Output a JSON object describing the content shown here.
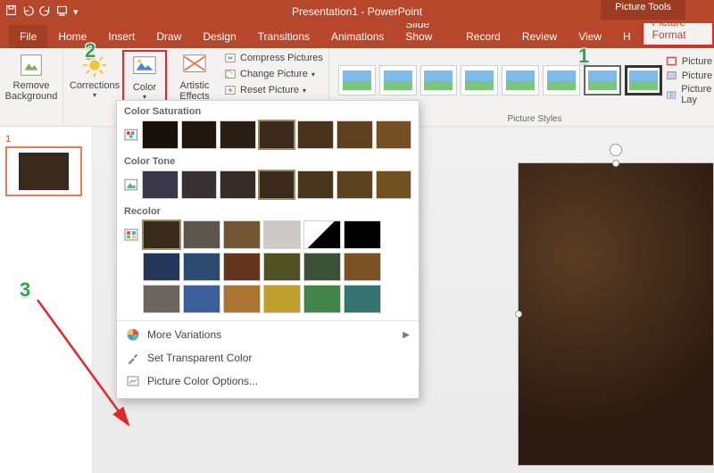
{
  "title": {
    "doc": "Presentation1",
    "app": "PowerPoint"
  },
  "context_tab": "Picture Tools",
  "tabs": {
    "file": "File",
    "home": "Home",
    "insert": "Insert",
    "draw": "Draw",
    "design": "Design",
    "transitions": "Transitions",
    "animations": "Animations",
    "slideshow": "Slide Show",
    "record": "Record",
    "review": "Review",
    "view": "View",
    "help": "H",
    "format": "Picture Format"
  },
  "ribbon": {
    "removebg": "Remove\nBackground",
    "corrections": "Corrections",
    "color": "Color",
    "artistic": "Artistic\nEffects",
    "compress": "Compress Pictures",
    "change": "Change Picture",
    "reset": "Reset Picture",
    "pstyles_label": "Picture Styles",
    "border": "Picture Bo",
    "effects": "Picture Ef",
    "layout": "Picture Lay"
  },
  "dropdown": {
    "saturation": "Color Saturation",
    "tone": "Color Tone",
    "recolor": "Recolor",
    "more_variations": "More Variations",
    "set_transparent": "Set Transparent Color",
    "options": "Picture Color Options..."
  },
  "slide": {
    "num": "1"
  },
  "callouts": {
    "one": "1",
    "two": "2",
    "three": "3"
  },
  "palette": {
    "saturation_overlays": [
      "rgba(0,0,0,.6)",
      "rgba(0,0,0,.45)",
      "rgba(0,0,0,.25)",
      "rgba(0,0,0,0)",
      "rgba(166,110,40,.15)",
      "rgba(166,110,40,.35)",
      "rgba(166,110,40,.55)"
    ],
    "tone_overlays": [
      "rgba(60,80,160,.35)",
      "rgba(60,80,160,.18)",
      "rgba(60,80,160,.08)",
      "rgba(0,0,0,0)",
      "rgba(200,140,40,.12)",
      "rgba(200,140,40,.25)",
      "rgba(200,140,40,.4)"
    ],
    "recolor_rows": [
      [
        "none",
        "rgba(120,120,120,.55)",
        "rgba(160,120,70,.55)",
        "rgba(255,255,255,.75)",
        "black_white",
        "#000"
      ],
      [
        "rgba(30,60,110,.75)",
        "rgba(40,90,150,.7)",
        "rgba(120,60,30,.7)",
        "rgba(90,100,40,.7)",
        "rgba(60,100,70,.7)",
        "rgba(150,100,40,.7)"
      ],
      [
        "rgba(150,150,150,.55)",
        "rgba(60,120,210,.7)",
        "rgba(220,150,60,.7)",
        "rgba(240,200,50,.75)",
        "rgba(70,170,90,.7)",
        "rgba(50,150,150,.7)"
      ]
    ]
  }
}
